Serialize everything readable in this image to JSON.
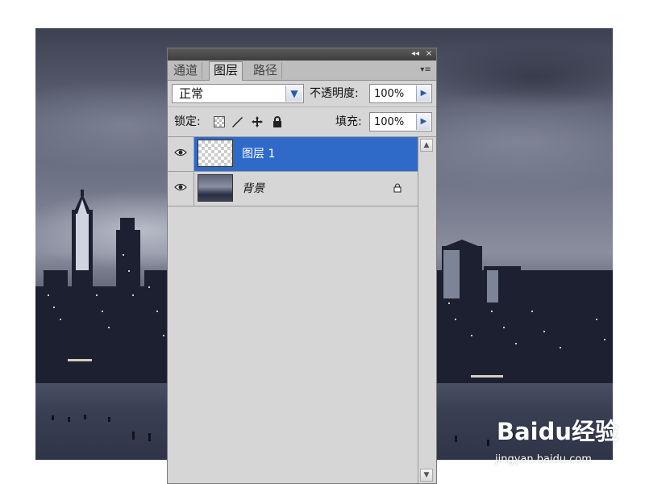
{
  "panel": {
    "tabs": [
      {
        "label": "通道",
        "active": false
      },
      {
        "label": "图层",
        "active": true
      },
      {
        "label": "路径",
        "active": false
      }
    ],
    "titlebar": {
      "collapse_glyph": "◂◂",
      "close_glyph": "×"
    },
    "menu_glyph": "▾≡",
    "blend_mode": "正常",
    "opacity_label": "不透明度:",
    "opacity_value": "100%",
    "lock_label": "锁定:",
    "fill_label": "填充:",
    "fill_value": "100%",
    "layers": [
      {
        "name": "图层 1",
        "selected": true,
        "visible": true,
        "thumbnail": "transparent",
        "locked": false
      },
      {
        "name": "背景",
        "selected": false,
        "visible": true,
        "thumbnail": "city-photo",
        "locked": true
      }
    ]
  },
  "watermark": {
    "logo_text": "Baidu经验",
    "url": "jingyan.baidu.com"
  },
  "colors": {
    "selection": "#2f6ac9",
    "panel_bg": "#d6d6d6",
    "titlebar": "#4a4a4a"
  }
}
